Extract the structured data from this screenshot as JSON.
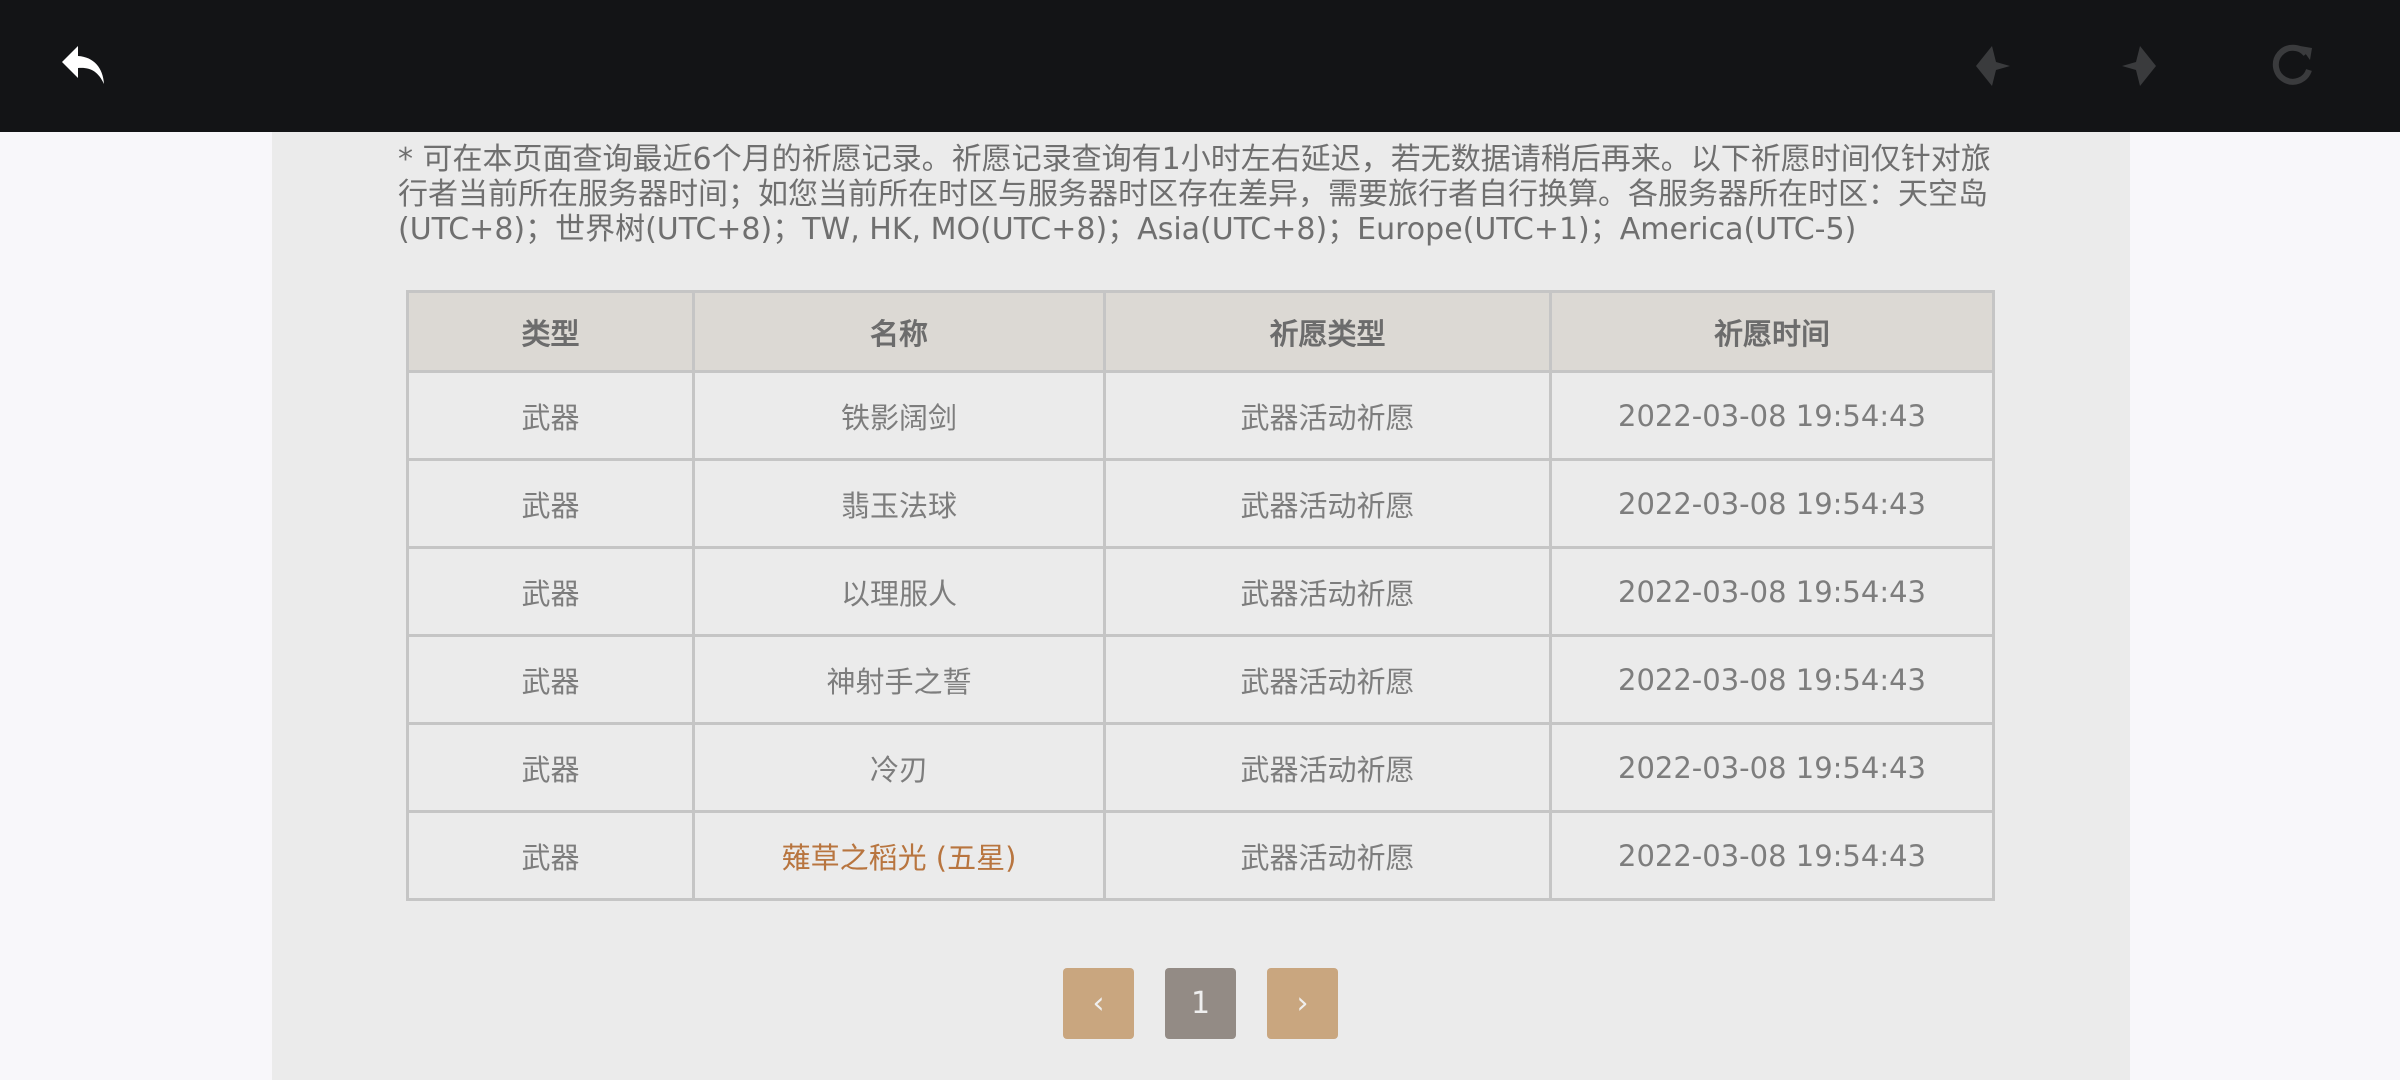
{
  "topbar": {
    "back_icon": "back-arrow-icon",
    "prev_icon": "prev-icon",
    "next_icon": "next-icon",
    "refresh_icon": "refresh-icon"
  },
  "notice": "* 可在本页面查询最近6个月的祈愿记录。祈愿记录查询有1小时左右延迟，若无数据请稍后再来。以下祈愿时间仅针对旅行者当前所在服务器时间；如您当前所在时区与服务器时区存在差异，需要旅行者自行换算。各服务器所在时区：天空岛(UTC+8)；世界树(UTC+8)；TW, HK, MO(UTC+8)；Asia(UTC+8)；Europe(UTC+1)；America(UTC-5)",
  "table": {
    "headers": [
      "类型",
      "名称",
      "祈愿类型",
      "祈愿时间"
    ],
    "rows": [
      [
        "武器",
        "铁影阔剑",
        "武器活动祈愿",
        "2022-03-08 19:54:43"
      ],
      [
        "武器",
        "翡玉法球",
        "武器活动祈愿",
        "2022-03-08 19:54:43"
      ],
      [
        "武器",
        "以理服人",
        "武器活动祈愿",
        "2022-03-08 19:54:43"
      ],
      [
        "武器",
        "神射手之誓",
        "武器活动祈愿",
        "2022-03-08 19:54:43"
      ],
      [
        "武器",
        "冷刃",
        "武器活动祈愿",
        "2022-03-08 19:54:43"
      ],
      [
        "武器",
        "薙草之稻光 (五星)",
        "武器活动祈愿",
        "2022-03-08 19:54:43"
      ]
    ]
  },
  "pagination": {
    "prev": "‹",
    "current": "1",
    "next": "›"
  },
  "colors": {
    "topbar": "#131416",
    "panel": "#ebebeb",
    "header_bg": "#dcd9d4",
    "five_star": "#b8753f",
    "pager_arrow": "#c9a67f",
    "pager_current": "#938b85"
  }
}
